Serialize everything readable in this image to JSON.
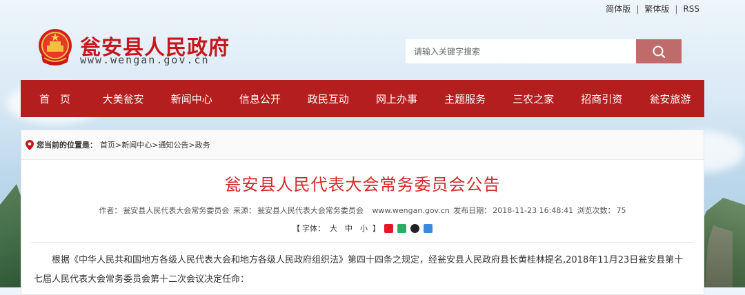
{
  "toplinks": {
    "simplified": "简体版",
    "traditional": "繁体版",
    "rss": "RSS",
    "sep": "|"
  },
  "logo": {
    "name": "瓮安县人民政府",
    "url": "www.wengan.gov.cn"
  },
  "search": {
    "placeholder": "请输入关键字搜索"
  },
  "nav": {
    "items": [
      {
        "label": "首　页"
      },
      {
        "label": "大美瓮安"
      },
      {
        "label": "新闻中心"
      },
      {
        "label": "信息公开"
      },
      {
        "label": "政民互动"
      },
      {
        "label": "网上办事"
      },
      {
        "label": "主题服务"
      },
      {
        "label": "三农之家"
      },
      {
        "label": "招商引资"
      },
      {
        "label": "瓮安旅游"
      }
    ]
  },
  "breadcrumb": {
    "label": "您当前的位置是：",
    "home": "首页",
    "news": "新闻中心",
    "notices": "通知公告",
    "current": "政务",
    "sep": ">"
  },
  "article": {
    "title": "瓮安县人民代表大会常务委员会公告",
    "meta": {
      "author_label": "作者：",
      "author": "瓮安县人民代表大会常务委员会",
      "source_label": "来源：",
      "source": "瓮安县人民代表大会常务委员会",
      "site": "www.wengan.gov.cn",
      "date_label": "发布日期：",
      "date": "2018-11-23 16:48:41",
      "views_label": "浏览次数：",
      "views": "75"
    },
    "tools": {
      "bracket_open": "【",
      "font_label": "字体：",
      "large": "大",
      "medium": "中",
      "small": "小",
      "bracket_close": "】"
    },
    "body": "根据《中华人民共和国地方各级人民代表大会和地方各级人民政府组织法》第四十四条之规定，经瓮安县人民政府县长黄桂林提名,2018年11月23日瓮安县第十七届人民代表大会常务委员会第十二次会议决定任命："
  },
  "colors": {
    "nav_bg": "#b41e1e",
    "brand_red": "#c8161d",
    "title_red": "#d42a2a",
    "search_btn": "#bf6b6b"
  }
}
